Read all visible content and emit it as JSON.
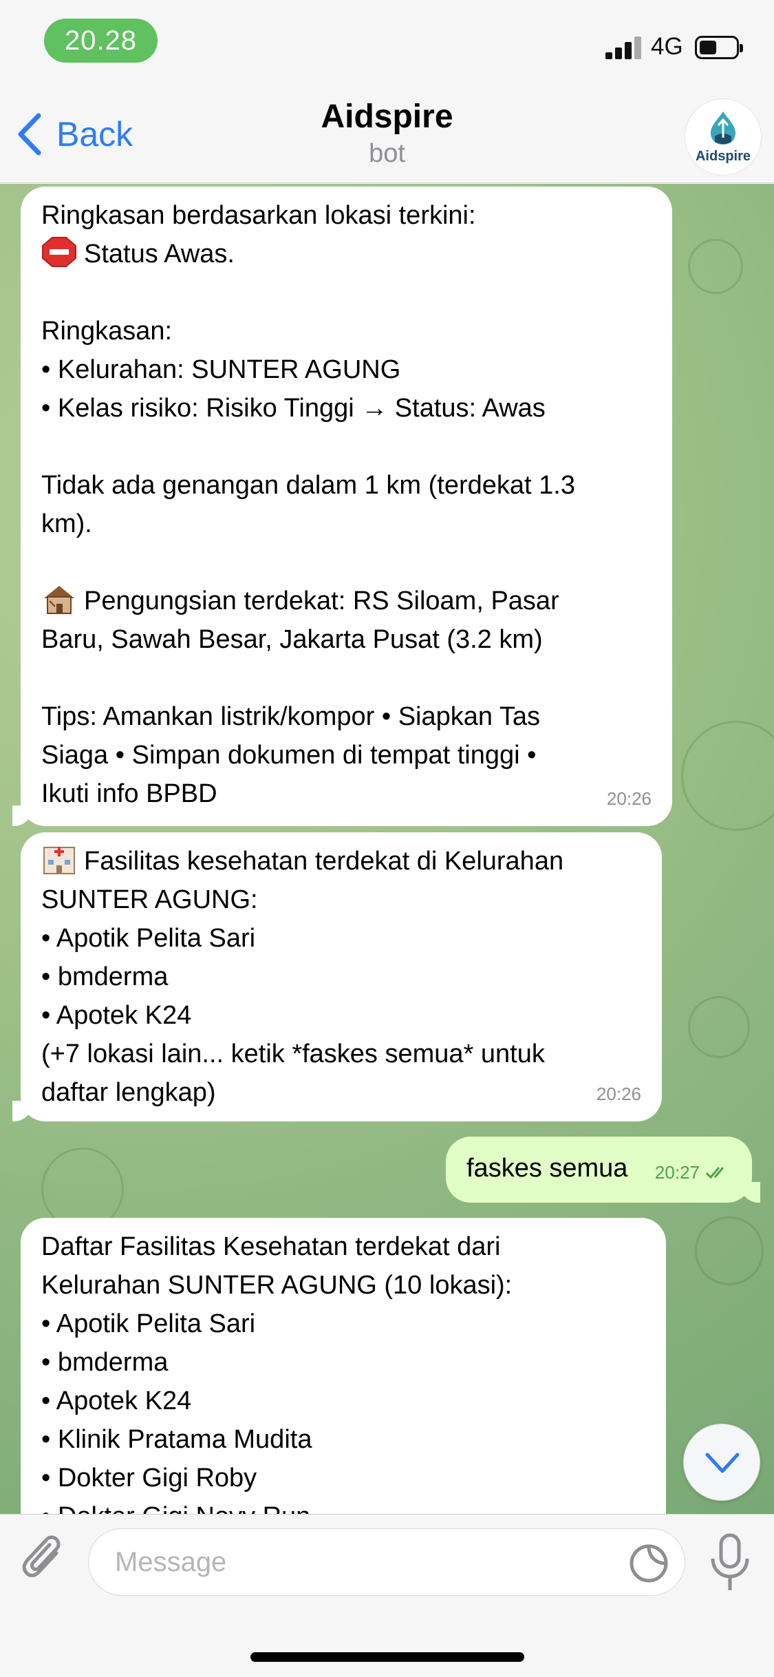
{
  "status_bar": {
    "time": "20.28",
    "network": "4G"
  },
  "nav": {
    "back_label": "Back",
    "title": "Aidspire",
    "subtitle": "bot",
    "avatar_text": "Aidspire"
  },
  "messages": [
    {
      "direction": "in",
      "text": "Ringkasan berdasarkan lokasi terkini:\n🛑 Status Awas.\n\nRingkasan:\n• Kelurahan: SUNTER AGUNG\n• Kelas risiko: Risiko Tinggi → Status: Awas\n\nTidak ada genangan dalam 1 km (terdekat 1.3 km).\n\n🏚 Pengungsian terdekat: RS Siloam, Pasar Baru, Sawah Besar, Jakarta Pusat (3.2 km)\n\nTips: Amankan listrik/kompor • Siapkan Tas Siaga • Simpan dokumen di tempat tinggi • Ikuti info BPBD",
      "time": "20:26"
    },
    {
      "direction": "in",
      "text": "🏥 Fasilitas kesehatan terdekat di Kelurahan SUNTER AGUNG:\n• Apotik Pelita Sari\n• bmderma\n• Apotek K24\n(+7 lokasi lain… ketik *faskes semua* untuk daftar lengkap)",
      "time": "20:26"
    },
    {
      "direction": "out",
      "text": "faskes semua",
      "time": "20:27"
    },
    {
      "direction": "in",
      "text": "Daftar Fasilitas Kesehatan terdekat dari Kelurahan SUNTER AGUNG (10 lokasi):\n• Apotik Pelita Sari\n• bmderma\n• Apotek K24\n• Klinik Pratama Mudita\n• Dokter Gigi Roby\n• Dokter Gigi Novy Run"
    }
  ],
  "msg1": {
    "l1": "Ringkasan berdasarkan lokasi terkini:",
    "l2": "Status Awas.",
    "l3": "Ringkasan:",
    "l4": "• Kelurahan: SUNTER AGUNG",
    "l5": "• Kelas risiko: Risiko Tinggi → Status: Awas",
    "l6": "Tidak ada genangan dalam 1 km (terdekat 1.3",
    "l7": "km).",
    "l8": "Pengungsian terdekat: RS Siloam, Pasar",
    "l9": "Baru, Sawah Besar, Jakarta Pusat (3.2 km)",
    "l10": "Tips: Amankan listrik/kompor • Siapkan Tas",
    "l11": "Siaga • Simpan dokumen di tempat tinggi •",
    "l12": "Ikuti info BPBD",
    "time": "20:26"
  },
  "msg2": {
    "l1": "Fasilitas kesehatan terdekat di Kelurahan",
    "l2": "SUNTER AGUNG:",
    "l3": "• Apotik Pelita Sari",
    "l4": "• bmderma",
    "l5": "• Apotek K24",
    "l6": "(+7 lokasi lain... ketik *faskes semua* untuk",
    "l7": "daftar lengkap)",
    "time": "20:26"
  },
  "msg3": {
    "text": "faskes semua",
    "time": "20:27"
  },
  "msg4": {
    "l1": "Daftar Fasilitas Kesehatan terdekat dari",
    "l2": "Kelurahan SUNTER AGUNG (10 lokasi):",
    "l3": "• Apotik Pelita Sari",
    "l4": "• bmderma",
    "l5": "• Apotek K24",
    "l6": "• Klinik Pratama Mudita",
    "l7": "• Dokter Gigi Roby",
    "l8": "• Dokter Gigi Novy Run"
  },
  "composer": {
    "placeholder": "Message"
  },
  "icons": {
    "back": "chevron-left-icon",
    "attach": "paperclip-icon",
    "sticker": "sticker-icon",
    "mic": "microphone-icon",
    "scroll": "chevron-down-icon",
    "stop": "stop-sign-emoji",
    "house": "derelict-house-emoji",
    "hospital": "hospital-emoji"
  },
  "colors": {
    "accent": "#2e7cf6",
    "outgoing_bubble": "#e1fec7",
    "time_pill": "#5fc15f"
  }
}
